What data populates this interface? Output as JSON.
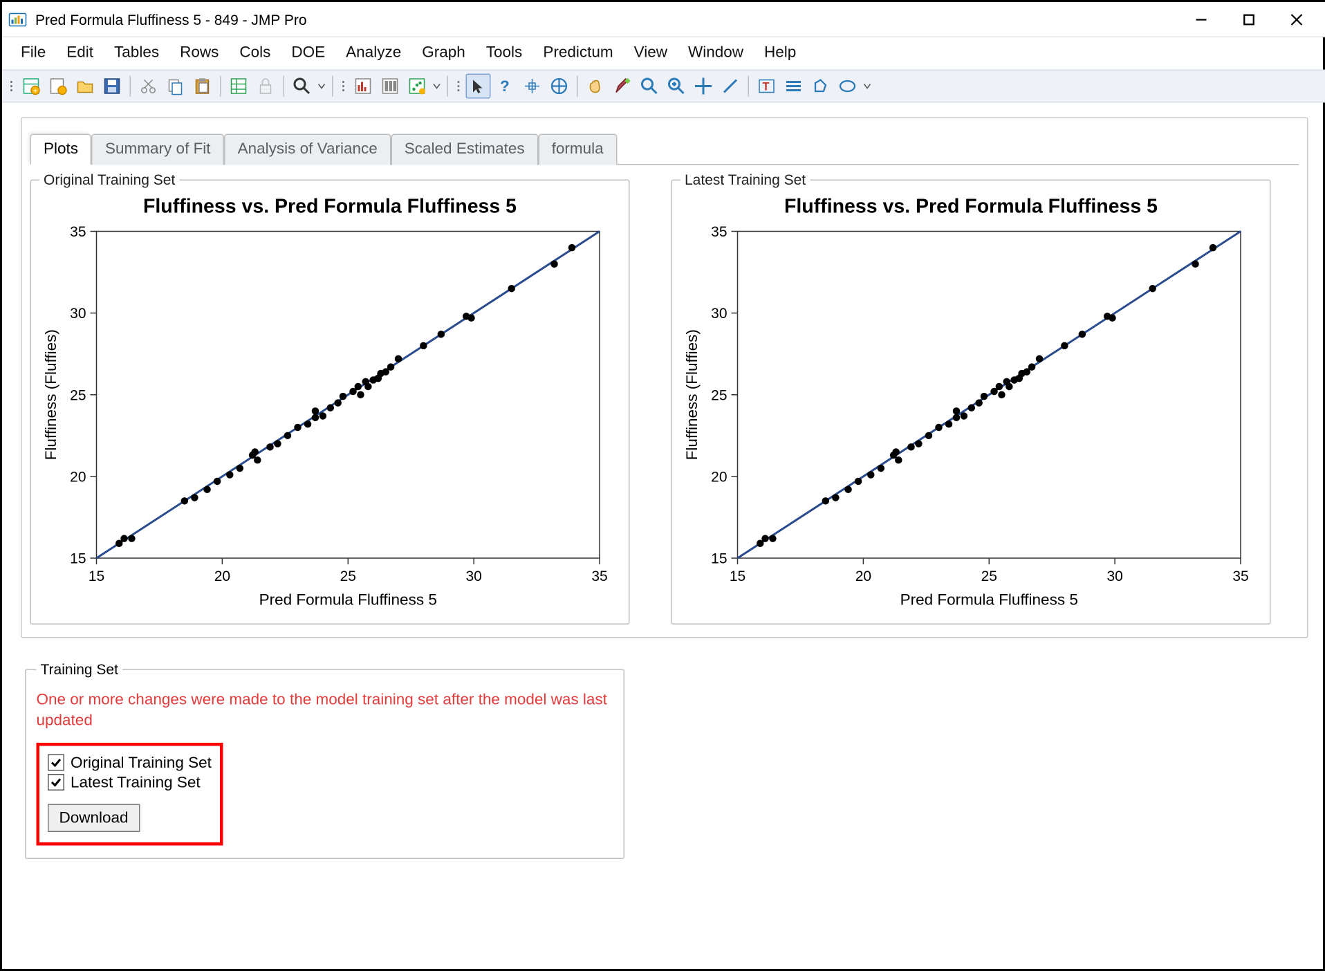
{
  "window": {
    "title": "Pred Formula Fluffiness 5 - 849 - JMP Pro"
  },
  "menu": {
    "items": [
      "File",
      "Edit",
      "Tables",
      "Rows",
      "Cols",
      "DOE",
      "Analyze",
      "Graph",
      "Tools",
      "Predictum",
      "View",
      "Window",
      "Help"
    ]
  },
  "tabs": {
    "items": [
      "Plots",
      "Summary of Fit",
      "Analysis of Variance",
      "Scaled Estimates",
      "formula"
    ],
    "active_index": 0
  },
  "plots": {
    "left_legend": "Original Training Set",
    "right_legend": "Latest Training Set",
    "chart_title": "Fluffiness vs. Pred Formula Fluffiness 5",
    "x_label": "Pred Formula Fluffiness 5",
    "y_label": "Fluffiness (Fluffies)"
  },
  "training_set": {
    "legend": "Training Set",
    "warning": "One or more changes were made to the model training set after the model was last updated",
    "chk1_label": "Original Training Set",
    "chk2_label": "Latest Training Set",
    "download_label": "Download"
  },
  "chart_data": [
    {
      "type": "scatter",
      "name": "Original Training Set",
      "title": "Fluffiness vs. Pred Formula Fluffiness 5",
      "xlabel": "Pred Formula Fluffiness 5",
      "ylabel": "Fluffiness (Fluffies)",
      "xlim": [
        15,
        35
      ],
      "ylim": [
        15,
        35
      ],
      "xticks": [
        15,
        20,
        25,
        30,
        35
      ],
      "yticks": [
        15,
        20,
        25,
        30,
        35
      ],
      "fit_line": {
        "x": [
          15,
          35
        ],
        "y": [
          15,
          35
        ]
      },
      "points": [
        {
          "x": 15.9,
          "y": 15.9
        },
        {
          "x": 16.1,
          "y": 16.2
        },
        {
          "x": 16.4,
          "y": 16.2
        },
        {
          "x": 18.5,
          "y": 18.5
        },
        {
          "x": 18.9,
          "y": 18.7
        },
        {
          "x": 19.4,
          "y": 19.2
        },
        {
          "x": 19.8,
          "y": 19.7
        },
        {
          "x": 20.3,
          "y": 20.1
        },
        {
          "x": 20.7,
          "y": 20.5
        },
        {
          "x": 21.2,
          "y": 21.3
        },
        {
          "x": 21.3,
          "y": 21.5
        },
        {
          "x": 21.4,
          "y": 21.0
        },
        {
          "x": 21.9,
          "y": 21.8
        },
        {
          "x": 22.2,
          "y": 22.0
        },
        {
          "x": 22.6,
          "y": 22.5
        },
        {
          "x": 23.0,
          "y": 23.0
        },
        {
          "x": 23.4,
          "y": 23.2
        },
        {
          "x": 23.7,
          "y": 23.6
        },
        {
          "x": 23.7,
          "y": 24.0
        },
        {
          "x": 24.0,
          "y": 23.7
        },
        {
          "x": 24.3,
          "y": 24.2
        },
        {
          "x": 24.6,
          "y": 24.5
        },
        {
          "x": 24.8,
          "y": 24.9
        },
        {
          "x": 25.2,
          "y": 25.2
        },
        {
          "x": 25.4,
          "y": 25.5
        },
        {
          "x": 25.5,
          "y": 25.0
        },
        {
          "x": 25.7,
          "y": 25.8
        },
        {
          "x": 25.8,
          "y": 25.5
        },
        {
          "x": 26.0,
          "y": 25.9
        },
        {
          "x": 26.2,
          "y": 26.0
        },
        {
          "x": 26.3,
          "y": 26.3
        },
        {
          "x": 26.5,
          "y": 26.4
        },
        {
          "x": 26.7,
          "y": 26.7
        },
        {
          "x": 27.0,
          "y": 27.2
        },
        {
          "x": 28.0,
          "y": 28.0
        },
        {
          "x": 28.7,
          "y": 28.7
        },
        {
          "x": 29.7,
          "y": 29.8
        },
        {
          "x": 29.9,
          "y": 29.7
        },
        {
          "x": 31.5,
          "y": 31.5
        },
        {
          "x": 33.2,
          "y": 33.0
        },
        {
          "x": 33.9,
          "y": 34.0
        }
      ]
    },
    {
      "type": "scatter",
      "name": "Latest Training Set",
      "title": "Fluffiness vs. Pred Formula Fluffiness 5",
      "xlabel": "Pred Formula Fluffiness 5",
      "ylabel": "Fluffiness (Fluffies)",
      "xlim": [
        15,
        35
      ],
      "ylim": [
        15,
        35
      ],
      "xticks": [
        15,
        20,
        25,
        30,
        35
      ],
      "yticks": [
        15,
        20,
        25,
        30,
        35
      ],
      "fit_line": {
        "x": [
          15,
          35
        ],
        "y": [
          15,
          35
        ]
      },
      "points": [
        {
          "x": 15.9,
          "y": 15.9
        },
        {
          "x": 16.1,
          "y": 16.2
        },
        {
          "x": 16.4,
          "y": 16.2
        },
        {
          "x": 18.5,
          "y": 18.5
        },
        {
          "x": 18.9,
          "y": 18.7
        },
        {
          "x": 19.4,
          "y": 19.2
        },
        {
          "x": 19.8,
          "y": 19.7
        },
        {
          "x": 20.3,
          "y": 20.1
        },
        {
          "x": 20.7,
          "y": 20.5
        },
        {
          "x": 21.2,
          "y": 21.3
        },
        {
          "x": 21.3,
          "y": 21.5
        },
        {
          "x": 21.4,
          "y": 21.0
        },
        {
          "x": 21.9,
          "y": 21.8
        },
        {
          "x": 22.2,
          "y": 22.0
        },
        {
          "x": 22.6,
          "y": 22.5
        },
        {
          "x": 23.0,
          "y": 23.0
        },
        {
          "x": 23.4,
          "y": 23.2
        },
        {
          "x": 23.7,
          "y": 23.6
        },
        {
          "x": 23.7,
          "y": 24.0
        },
        {
          "x": 24.0,
          "y": 23.7
        },
        {
          "x": 24.3,
          "y": 24.2
        },
        {
          "x": 24.6,
          "y": 24.5
        },
        {
          "x": 24.8,
          "y": 24.9
        },
        {
          "x": 25.2,
          "y": 25.2
        },
        {
          "x": 25.4,
          "y": 25.5
        },
        {
          "x": 25.5,
          "y": 25.0
        },
        {
          "x": 25.7,
          "y": 25.8
        },
        {
          "x": 25.8,
          "y": 25.5
        },
        {
          "x": 26.0,
          "y": 25.9
        },
        {
          "x": 26.2,
          "y": 26.0
        },
        {
          "x": 26.3,
          "y": 26.3
        },
        {
          "x": 26.5,
          "y": 26.4
        },
        {
          "x": 26.7,
          "y": 26.7
        },
        {
          "x": 27.0,
          "y": 27.2
        },
        {
          "x": 28.0,
          "y": 28.0
        },
        {
          "x": 28.7,
          "y": 28.7
        },
        {
          "x": 29.7,
          "y": 29.8
        },
        {
          "x": 29.9,
          "y": 29.7
        },
        {
          "x": 31.5,
          "y": 31.5
        },
        {
          "x": 33.2,
          "y": 33.0
        },
        {
          "x": 33.9,
          "y": 34.0
        }
      ]
    }
  ]
}
